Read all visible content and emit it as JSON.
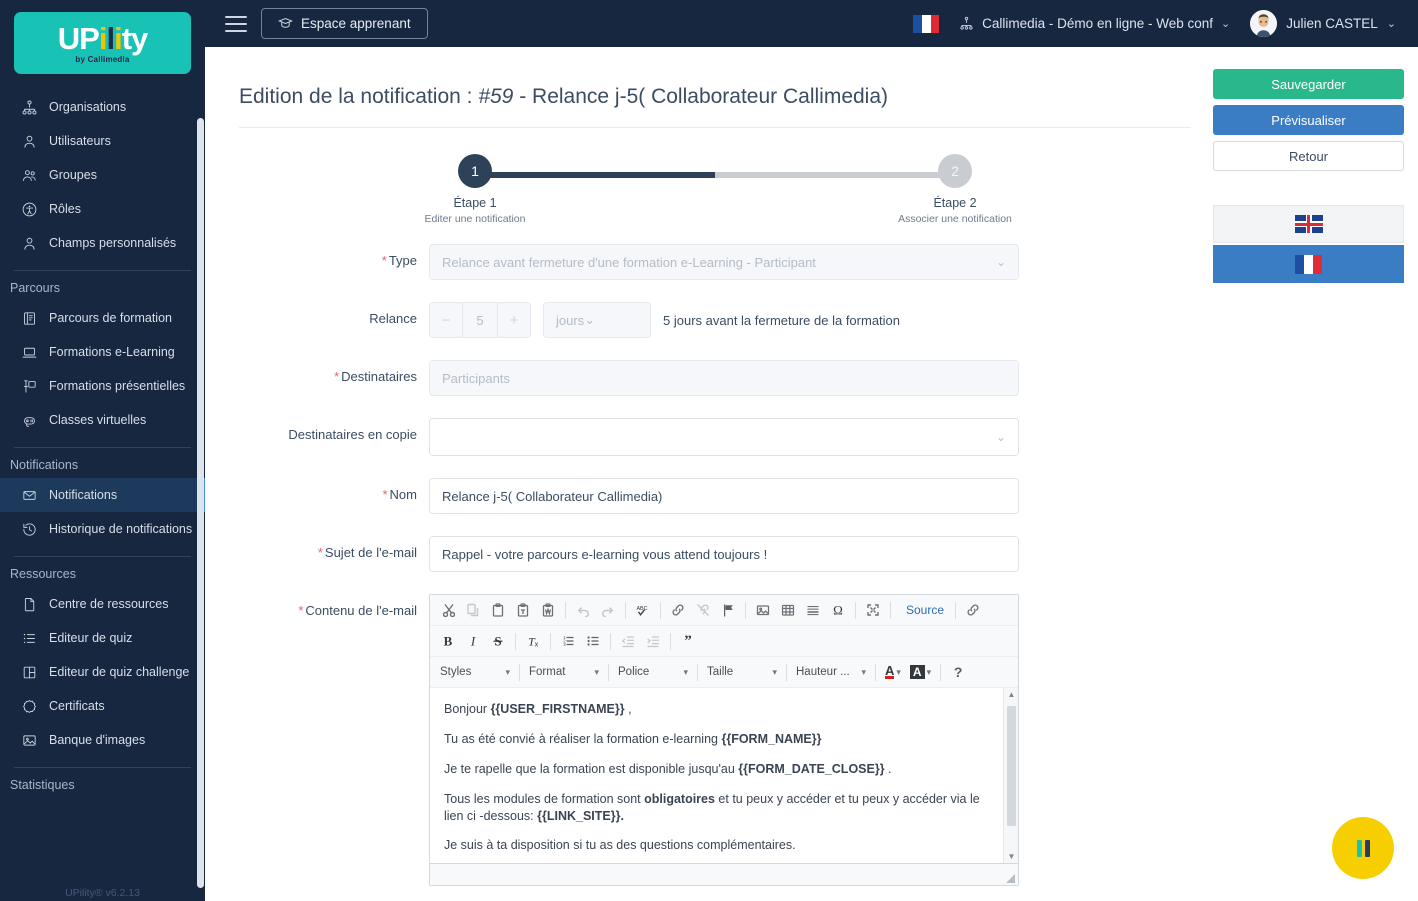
{
  "brand": {
    "logo_text": "UPility",
    "logo_sub": "by Callimedia",
    "version": "UPility® v6.2.13",
    "accent_teal": "#18c2b4",
    "accent_yellow": "#f5c400",
    "sidebar_bg": "#17273f"
  },
  "topbar": {
    "menu_icon": "hamburger-icon",
    "learner_button": "Espace apprenant",
    "learner_icon": "graduation-cap-icon",
    "language_flag": "flag-france-icon",
    "organisation": "Callimedia - Démo en ligne - Web conf",
    "organisation_icon": "sitemap-icon",
    "user_name": "Julien CASTEL",
    "caret": "⌄"
  },
  "sidebar": {
    "groups": [
      {
        "title": "",
        "items": [
          {
            "label": "Organisations",
            "icon": "sitemap-icon",
            "active": false
          },
          {
            "label": "Utilisateurs",
            "icon": "user-icon",
            "active": false
          },
          {
            "label": "Groupes",
            "icon": "users-icon",
            "active": false
          },
          {
            "label": "Rôles",
            "icon": "accessibility-icon",
            "active": false
          },
          {
            "label": "Champs personnalisés",
            "icon": "user-icon",
            "active": false
          }
        ]
      },
      {
        "title": "Parcours",
        "items": [
          {
            "label": "Parcours de formation",
            "icon": "book-icon",
            "active": false
          },
          {
            "label": "Formations e-Learning",
            "icon": "laptop-icon",
            "active": false
          },
          {
            "label": "Formations présentielles",
            "icon": "presentation-icon",
            "active": false
          },
          {
            "label": "Classes virtuelles",
            "icon": "headset-icon",
            "active": false
          }
        ]
      },
      {
        "title": "Notifications",
        "items": [
          {
            "label": "Notifications",
            "icon": "envelope-icon",
            "active": true
          },
          {
            "label": "Historique de notifications",
            "icon": "history-icon",
            "active": false
          }
        ]
      },
      {
        "title": "Ressources",
        "items": [
          {
            "label": "Centre de ressources",
            "icon": "file-icon",
            "active": false
          },
          {
            "label": "Editeur de quiz",
            "icon": "list-icon",
            "active": false
          },
          {
            "label": "Editeur de quiz challenge",
            "icon": "grid-icon",
            "active": false
          },
          {
            "label": "Certificats",
            "icon": "certificate-icon",
            "active": false
          },
          {
            "label": "Banque d'images",
            "icon": "image-icon",
            "active": false
          }
        ]
      },
      {
        "title": "Statistiques",
        "items": []
      }
    ]
  },
  "page": {
    "title_prefix": "Edition de la notification : ",
    "title_id": "#59",
    "title_suffix": " - Relance j-5( Collaborateur Callimedia)"
  },
  "stepper": {
    "progress_percent": 50,
    "steps": [
      {
        "number": "1",
        "title": "Étape 1",
        "subtitle": "Editer une notification",
        "active": true
      },
      {
        "number": "2",
        "title": "Étape 2",
        "subtitle": "Associer une notification",
        "active": false
      }
    ]
  },
  "form": {
    "type": {
      "label": "Type",
      "required": true,
      "value": "Relance avant fermeture d'une formation e-Learning - Participant",
      "disabled": true
    },
    "relance": {
      "label": "Relance",
      "required": false,
      "minus": "−",
      "value": "5",
      "plus": "+",
      "unit": "jours",
      "hint": "5 jours avant la fermeture de la formation",
      "disabled": true
    },
    "destinataires": {
      "label": "Destinataires",
      "required": true,
      "value": "Participants",
      "disabled": true
    },
    "destinataires_copie": {
      "label": "Destinataires en copie",
      "required": false,
      "value": "",
      "placeholder": ""
    },
    "nom": {
      "label": "Nom",
      "required": true,
      "value": "Relance j-5( Collaborateur Callimedia)"
    },
    "sujet": {
      "label": "Sujet de l'e-mail",
      "required": true,
      "value": "Rappel - votre parcours e-learning vous attend toujours !"
    },
    "contenu": {
      "label": "Contenu de l'e-mail",
      "required": true
    }
  },
  "editor": {
    "toolbar_row1": [
      {
        "name": "cut-icon",
        "glyph": "✂",
        "dim": false
      },
      {
        "name": "copy-icon",
        "glyph": "❏",
        "dim": true
      },
      {
        "name": "paste-icon",
        "glyph": "📋",
        "dim": false
      },
      {
        "name": "paste-text-icon",
        "glyph": "📋",
        "dim": false
      },
      {
        "name": "paste-word-icon",
        "glyph": "📋",
        "dim": false
      },
      {
        "name": "separator",
        "glyph": "",
        "dim": false
      },
      {
        "name": "undo-icon",
        "glyph": "↶",
        "dim": true
      },
      {
        "name": "redo-icon",
        "glyph": "↷",
        "dim": true
      },
      {
        "name": "separator",
        "glyph": "",
        "dim": false
      },
      {
        "name": "spellcheck-icon",
        "glyph": "ABC",
        "dim": false
      },
      {
        "name": "separator",
        "glyph": "",
        "dim": false
      },
      {
        "name": "link-icon",
        "glyph": "🔗",
        "dim": false
      },
      {
        "name": "unlink-icon",
        "glyph": "🔗",
        "dim": true
      },
      {
        "name": "anchor-icon",
        "glyph": "⚑",
        "dim": false
      },
      {
        "name": "separator",
        "glyph": "",
        "dim": false
      },
      {
        "name": "image-icon",
        "glyph": "🖼",
        "dim": false
      },
      {
        "name": "table-icon",
        "glyph": "▦",
        "dim": false
      },
      {
        "name": "horizontal-rule-icon",
        "glyph": "▤",
        "dim": false
      },
      {
        "name": "special-char-icon",
        "glyph": "Ω",
        "dim": false
      },
      {
        "name": "separator",
        "glyph": "",
        "dim": false
      },
      {
        "name": "maximize-icon",
        "glyph": "⤢",
        "dim": false
      }
    ],
    "source_label": "Source",
    "toolbar_row2": [
      {
        "name": "bold-icon",
        "glyph": "B",
        "dim": false
      },
      {
        "name": "italic-icon",
        "glyph": "I",
        "dim": false
      },
      {
        "name": "strikethrough-icon",
        "glyph": "S",
        "dim": false
      },
      {
        "name": "separator",
        "glyph": "",
        "dim": false
      },
      {
        "name": "remove-format-icon",
        "glyph": "Tx",
        "dim": false
      },
      {
        "name": "separator",
        "glyph": "",
        "dim": false
      },
      {
        "name": "numbered-list-icon",
        "glyph": "≔",
        "dim": false
      },
      {
        "name": "bulleted-list-icon",
        "glyph": "⁝≡",
        "dim": false
      },
      {
        "name": "separator",
        "glyph": "",
        "dim": false
      },
      {
        "name": "outdent-icon",
        "glyph": "⇤",
        "dim": true
      },
      {
        "name": "indent-icon",
        "glyph": "⇥",
        "dim": true
      },
      {
        "name": "separator",
        "glyph": "",
        "dim": false
      },
      {
        "name": "blockquote-icon",
        "glyph": "❞",
        "dim": false
      }
    ],
    "combos": [
      {
        "name": "styles-combo",
        "label": "Styles"
      },
      {
        "name": "format-combo",
        "label": "Format"
      },
      {
        "name": "font-combo",
        "label": "Police"
      },
      {
        "name": "size-combo",
        "label": "Taille"
      },
      {
        "name": "lineheight-combo",
        "label": "Hauteur ..."
      }
    ],
    "text_color_label": "A",
    "bg_color_label": "A",
    "help_label": "?",
    "content": [
      {
        "segments": [
          {
            "t": "Bonjour  ",
            "b": false
          },
          {
            "t": "{{USER_FIRSTNAME}}",
            "b": true
          },
          {
            "t": " ,",
            "b": false
          }
        ]
      },
      {
        "segments": [
          {
            "t": "Tu as été convié à réaliser la formation e-learning  ",
            "b": false
          },
          {
            "t": "{{FORM_NAME}}",
            "b": true
          }
        ]
      },
      {
        "segments": [
          {
            "t": "Je te rapelle que la formation est disponible jusqu'au  ",
            "b": false
          },
          {
            "t": "{{FORM_DATE_CLOSE}}",
            "b": true
          },
          {
            "t": " .",
            "b": false
          }
        ]
      },
      {
        "segments": [
          {
            "t": "Tous les modules de formation sont ",
            "b": false
          },
          {
            "t": "obligatoires",
            "b": true
          },
          {
            "t": " et tu peux y accéder et tu peux y accéder via le lien ci -dessous:  ",
            "b": false
          },
          {
            "t": "{{LINK_SITE}}.",
            "b": true
          }
        ]
      },
      {
        "segments": [
          {
            "t": "Je suis à ta disposition si tu as des questions complémentaires.",
            "b": false
          }
        ]
      }
    ]
  },
  "actions": {
    "save": "Sauvegarder",
    "preview": "Prévisualiser",
    "back": "Retour",
    "save_color": "#29b88c",
    "preview_color": "#3b7dc4",
    "languages": [
      {
        "name": "lang-en",
        "icon": "flag-uk-icon",
        "active": false
      },
      {
        "name": "lang-fr",
        "icon": "flag-france-icon",
        "active": true
      }
    ]
  },
  "fab": {
    "name": "help-widget-button",
    "color": "#f7cf00"
  }
}
